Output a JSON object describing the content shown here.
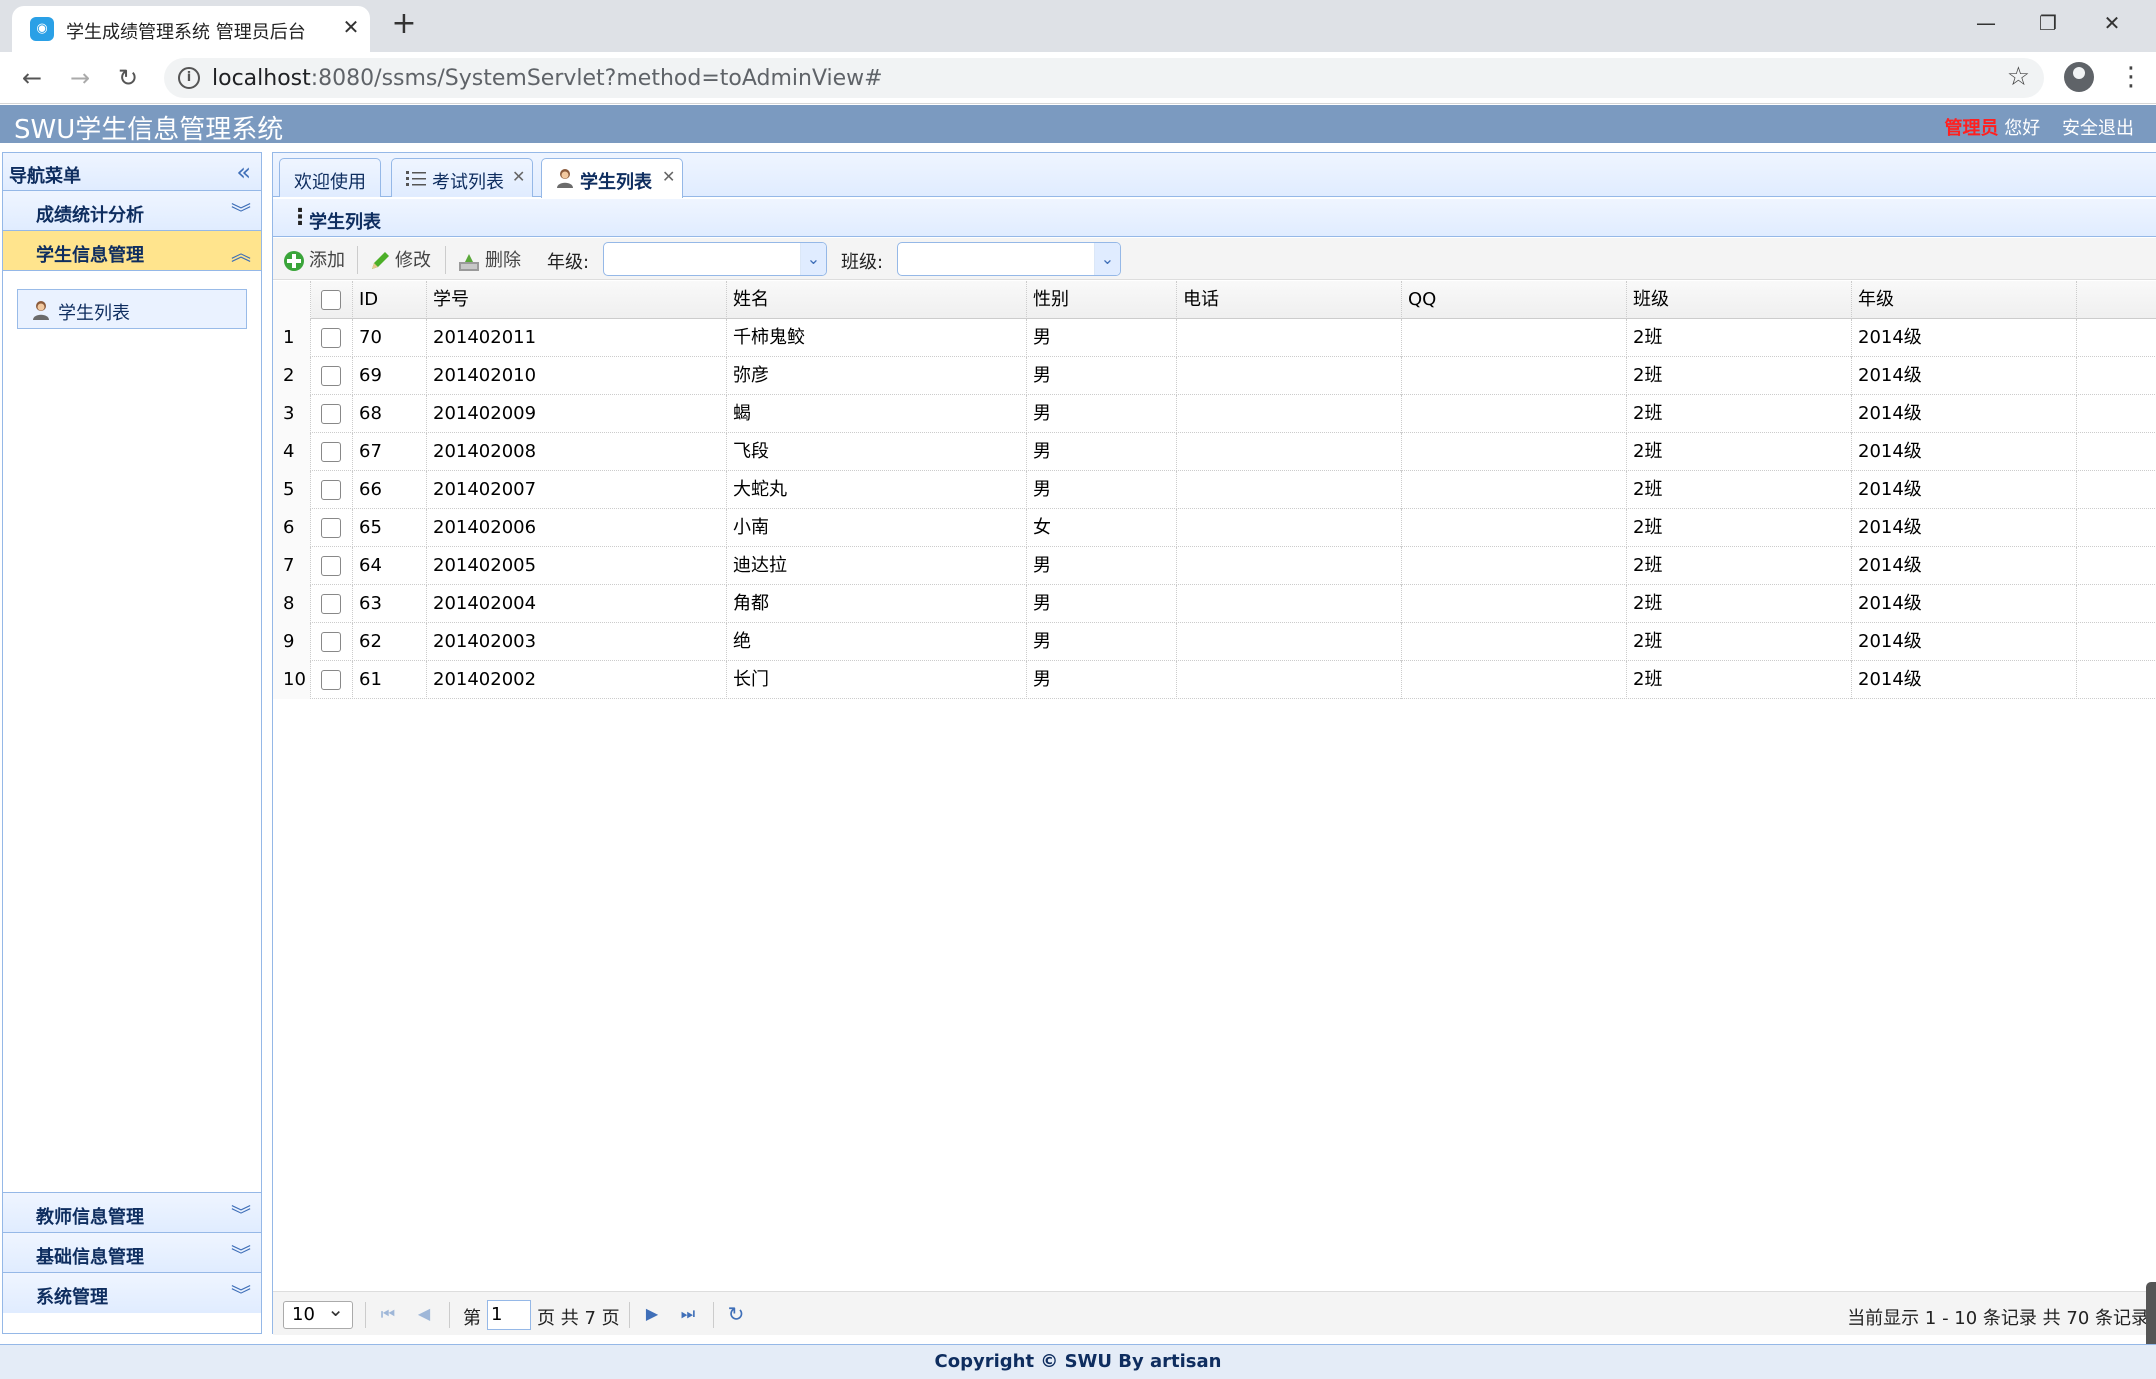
{
  "browser": {
    "tab_title": "学生成绩管理系统 管理员后台",
    "url_host": "localhost",
    "url_rest": ":8080/ssms/SystemServlet?method=toAdminView#"
  },
  "header": {
    "title": "SWU学生信息管理系统",
    "role": "管理员",
    "greeting": "您好",
    "logout": "安全退出"
  },
  "nav": {
    "title": "导航菜单",
    "sections": [
      {
        "label": "成绩统计分析"
      },
      {
        "label": "学生信息管理",
        "selected": true,
        "items": [
          {
            "label": "学生列表"
          }
        ]
      },
      {
        "label": "教师信息管理"
      },
      {
        "label": "基础信息管理"
      },
      {
        "label": "系统管理"
      }
    ]
  },
  "tabs": [
    {
      "label": "欢迎使用"
    },
    {
      "label": "考试列表"
    },
    {
      "label": "学生列表",
      "active": true
    }
  ],
  "panel": {
    "title": "学生列表"
  },
  "toolbar": {
    "add": "添加",
    "edit": "修改",
    "delete": "删除",
    "grade_label": "年级:",
    "class_label": "班级:",
    "grade_value": "",
    "class_value": ""
  },
  "grid": {
    "columns": [
      "ID",
      "学号",
      "姓名",
      "性别",
      "电话",
      "QQ",
      "班级",
      "年级"
    ],
    "rows": [
      {
        "n": "1",
        "id": "70",
        "sno": "201402011",
        "name": "千柿鬼鲛",
        "sex": "男",
        "phone": "",
        "qq": "",
        "clazz": "2班",
        "grade": "2014级"
      },
      {
        "n": "2",
        "id": "69",
        "sno": "201402010",
        "name": "弥彦",
        "sex": "男",
        "phone": "",
        "qq": "",
        "clazz": "2班",
        "grade": "2014级"
      },
      {
        "n": "3",
        "id": "68",
        "sno": "201402009",
        "name": "蝎",
        "sex": "男",
        "phone": "",
        "qq": "",
        "clazz": "2班",
        "grade": "2014级"
      },
      {
        "n": "4",
        "id": "67",
        "sno": "201402008",
        "name": "飞段",
        "sex": "男",
        "phone": "",
        "qq": "",
        "clazz": "2班",
        "grade": "2014级"
      },
      {
        "n": "5",
        "id": "66",
        "sno": "201402007",
        "name": "大蛇丸",
        "sex": "男",
        "phone": "",
        "qq": "",
        "clazz": "2班",
        "grade": "2014级"
      },
      {
        "n": "6",
        "id": "65",
        "sno": "201402006",
        "name": "小南",
        "sex": "女",
        "phone": "",
        "qq": "",
        "clazz": "2班",
        "grade": "2014级"
      },
      {
        "n": "7",
        "id": "64",
        "sno": "201402005",
        "name": "迪达拉",
        "sex": "男",
        "phone": "",
        "qq": "",
        "clazz": "2班",
        "grade": "2014级"
      },
      {
        "n": "8",
        "id": "63",
        "sno": "201402004",
        "name": "角都",
        "sex": "男",
        "phone": "",
        "qq": "",
        "clazz": "2班",
        "grade": "2014级"
      },
      {
        "n": "9",
        "id": "62",
        "sno": "201402003",
        "name": "绝",
        "sex": "男",
        "phone": "",
        "qq": "",
        "clazz": "2班",
        "grade": "2014级"
      },
      {
        "n": "10",
        "id": "61",
        "sno": "201402002",
        "name": "长门",
        "sex": "男",
        "phone": "",
        "qq": "",
        "clazz": "2班",
        "grade": "2014级"
      }
    ]
  },
  "pager": {
    "page_size": "10",
    "page_prefix": "第",
    "page_value": "1",
    "page_suffix": "页 共 7 页",
    "info": "当前显示 1 - 10 条记录 共 70 条记录"
  },
  "footer": {
    "text": "Copyright © SWU By artisan"
  },
  "colors": {
    "header_bg": "#7b9ac0",
    "accent_border": "#95b8e7",
    "selected_section": "#ffe48d",
    "role_text": "#ff2020"
  }
}
